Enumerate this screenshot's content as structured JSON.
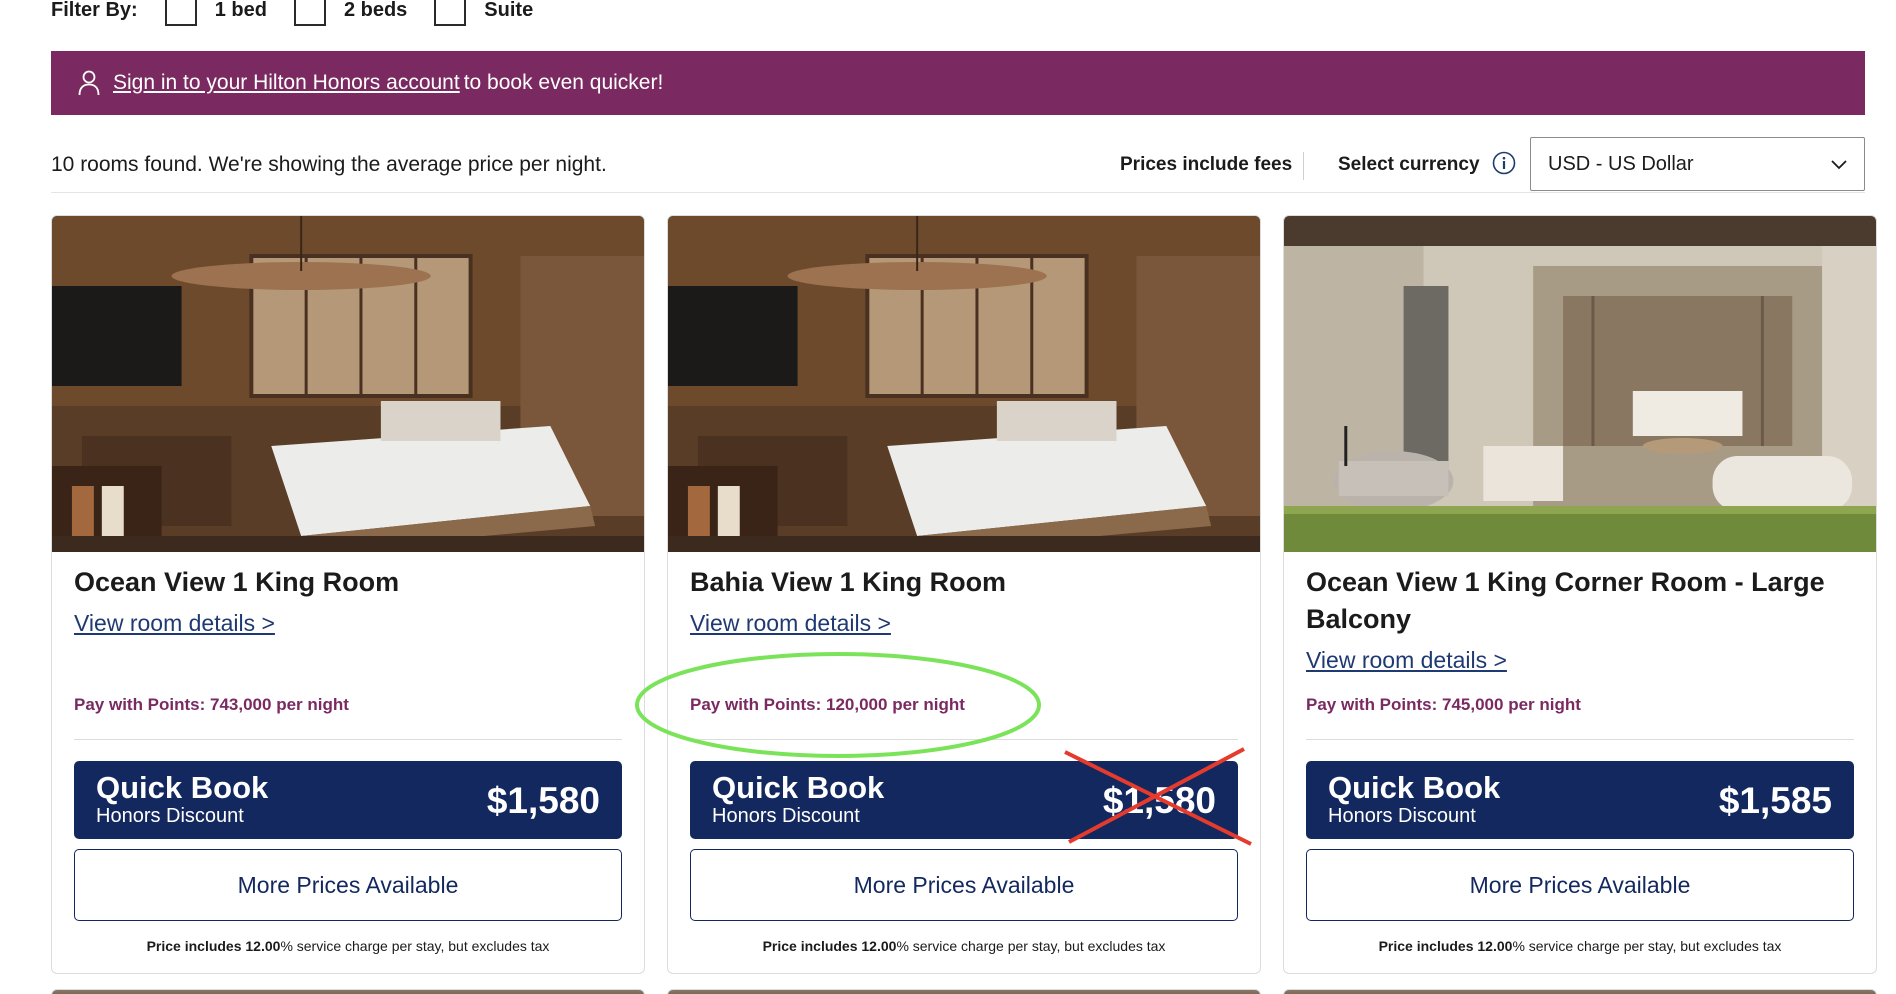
{
  "filters": {
    "label": "Filter By:",
    "options": [
      {
        "label": "1 bed"
      },
      {
        "label": "2 beds"
      },
      {
        "label": "Suite"
      }
    ]
  },
  "banner": {
    "link_text": "Sign in to your Hilton Honors account",
    "text": "to book even quicker!",
    "icon": "user-icon",
    "color": "#7a2a60"
  },
  "results": {
    "summary": "10 rooms found. We're showing the average price per night.",
    "prices_note": "Prices include fees",
    "select_currency_label": "Select currency",
    "currency_value": "USD - US Dollar"
  },
  "rooms": [
    {
      "name": "Ocean View 1 King Room",
      "details_link": "View room details >",
      "points": "Pay with Points: 743,000 per night",
      "quick_book_title": "Quick Book",
      "quick_book_sub": "Honors Discount",
      "price": "$1,580",
      "more_prices": "More Prices Available",
      "note_bold": "Price includes 12.00",
      "note_rest": "% service charge per stay, but excludes tax"
    },
    {
      "name": "Bahia View 1 King Room",
      "details_link": "View room details >",
      "points": "Pay with Points: 120,000 per night",
      "quick_book_title": "Quick Book",
      "quick_book_sub": "Honors Discount",
      "price": "$1,580",
      "more_prices": "More Prices Available",
      "note_bold": "Price includes 12.00",
      "note_rest": "% service charge per stay, but excludes tax"
    },
    {
      "name": "Ocean View 1 King Corner Room - Large Balcony",
      "details_link": "View room details >",
      "points": "Pay with Points: 745,000 per night",
      "quick_book_title": "Quick Book",
      "quick_book_sub": "Honors Discount",
      "price": "$1,585",
      "more_prices": "More Prices Available",
      "note_bold": "Price includes 12.00",
      "note_rest": "% service charge per stay, but excludes tax"
    }
  ],
  "colors": {
    "brand_purple": "#7a2a60",
    "navy": "#12285f",
    "link_blue": "#1f3a72",
    "annotation_green": "#7be35a",
    "annotation_red": "#e53b2c"
  }
}
